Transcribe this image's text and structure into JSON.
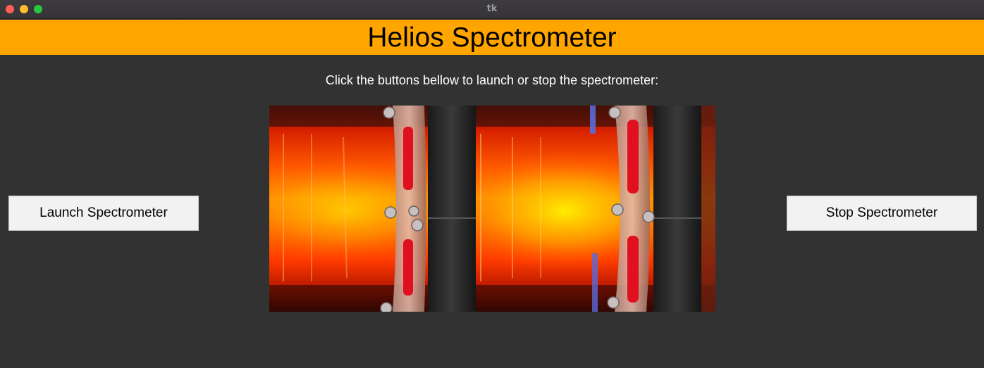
{
  "window": {
    "title": "tk"
  },
  "header": {
    "title": "Helios Spectrometer",
    "background": "#ffa500"
  },
  "main": {
    "instructions": "Click the buttons bellow to launch or stop the spectrometer:",
    "launch_label": "Launch Spectrometer",
    "stop_label": "Stop Spectrometer",
    "image": {
      "description_icon": "spectrometer-photo"
    }
  },
  "colors": {
    "background": "#323232",
    "button": "#f2f2f2",
    "text_light": "#ffffff"
  }
}
